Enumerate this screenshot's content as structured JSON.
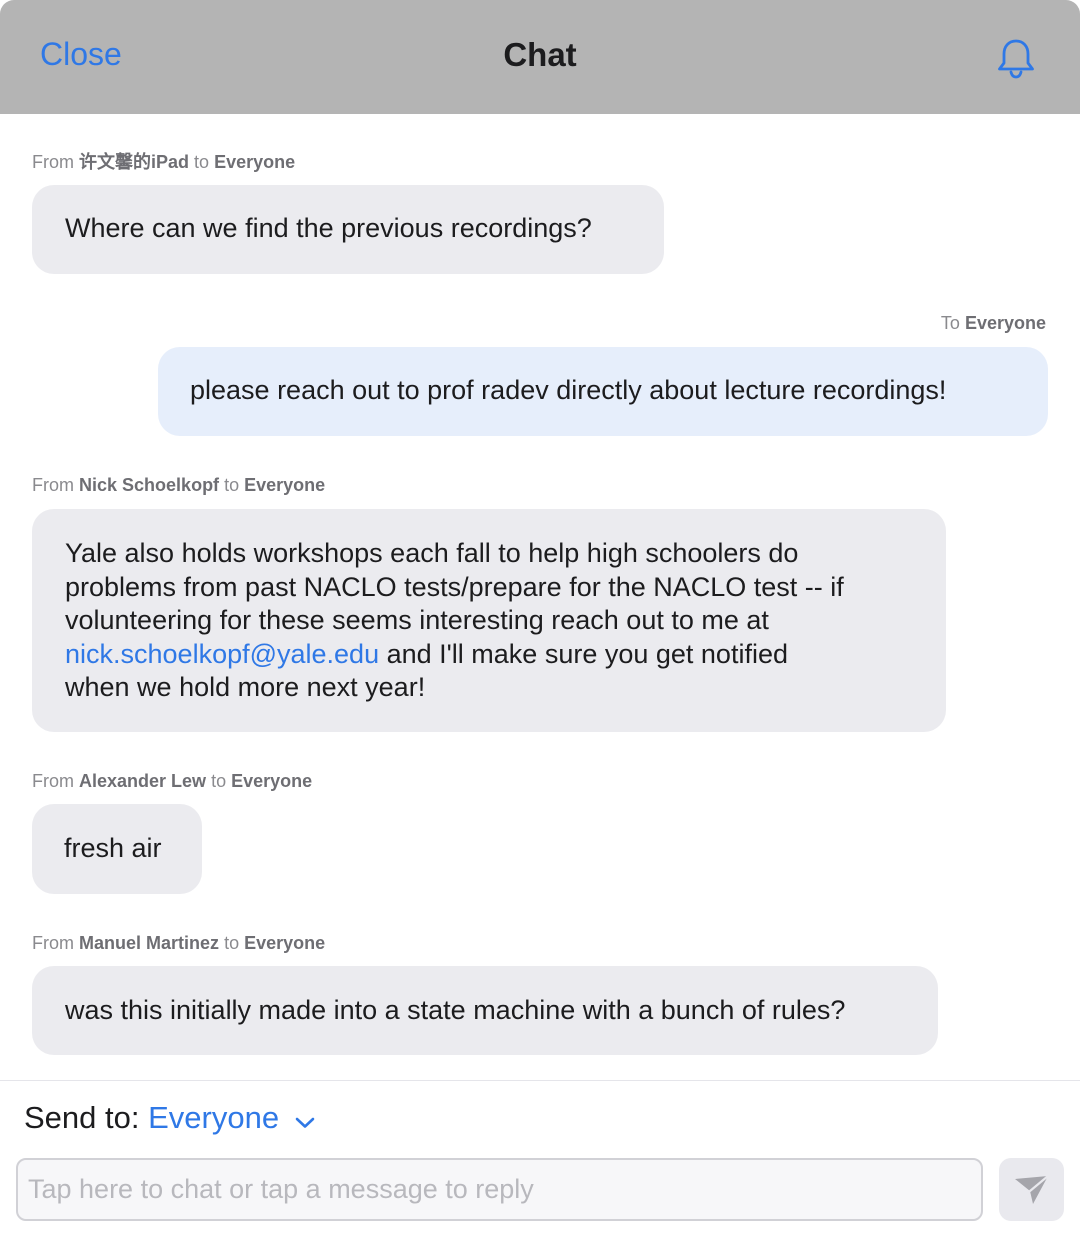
{
  "header": {
    "close_label": "Close",
    "title": "Chat",
    "bell_icon": "bell-icon"
  },
  "messages": [
    {
      "from_prefix": "From",
      "sender": "许文馨的iPad",
      "to_prefix": "to",
      "recipient": "Everyone",
      "text": "Where can we find the previous recordings?"
    },
    {
      "to_prefix": "To",
      "recipient": "Everyone",
      "text": "please reach out to prof radev directly about lecture recordings!"
    },
    {
      "from_prefix": "From",
      "sender": "Nick Schoelkopf",
      "to_prefix": "to",
      "recipient": "Everyone",
      "line1": "Yale also holds workshops each fall to help high schoolers do",
      "line2": "problems from past NACLO tests/prepare for the NACLO test -- if",
      "line3": "volunteering for these seems interesting reach out to me at",
      "link": "nick.schoelkopf@yale.edu",
      "line4_rest": " and I'll make sure you get notified",
      "line5": "when we hold more next year!"
    },
    {
      "from_prefix": "From",
      "sender": "Alexander Lew",
      "to_prefix": "to",
      "recipient": "Everyone",
      "text": "fresh air"
    },
    {
      "from_prefix": "From",
      "sender": "Manuel Martinez",
      "to_prefix": "to",
      "recipient": "Everyone",
      "text": "was this initially made into a state machine with a bunch of rules?"
    }
  ],
  "composer": {
    "send_to_label": "Send to:",
    "send_to_value": "Everyone",
    "placeholder": "Tap here to chat or tap a message to reply",
    "chevron_icon": "chevron-down-icon",
    "send_icon": "paper-plane-icon"
  },
  "colors": {
    "accent": "#2f78e6",
    "header_bg": "#b4b4b4",
    "bubble_bg": "#ebebef",
    "own_bubble_bg": "#e6eefb"
  }
}
